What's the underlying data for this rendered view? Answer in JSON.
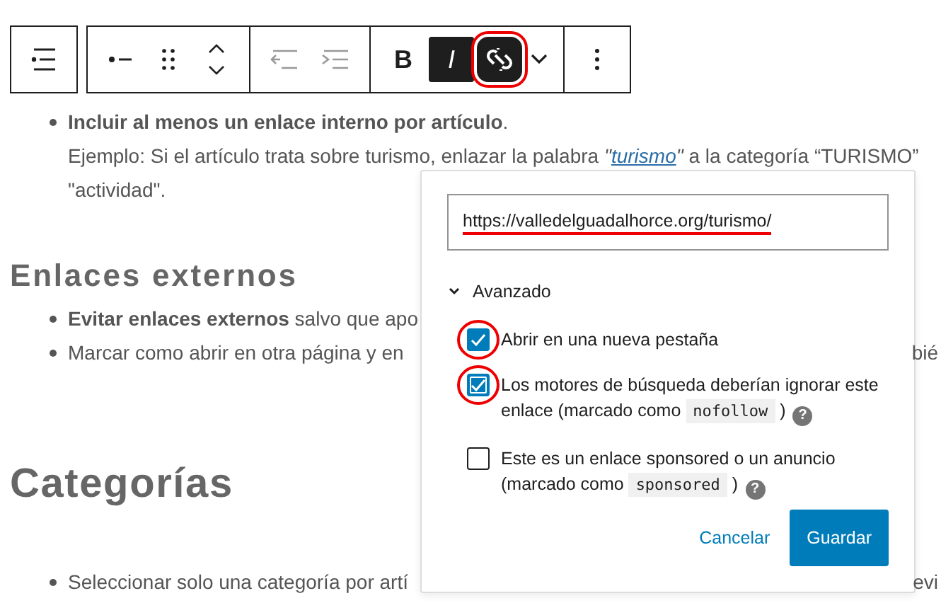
{
  "toolbar": {
    "groups": [
      {
        "buttons": [
          {
            "kind": "list",
            "pressed": false,
            "disabled": false,
            "circled": false
          }
        ]
      },
      {
        "buttons": [
          {
            "kind": "bullet",
            "pressed": false,
            "disabled": false,
            "circled": false
          },
          {
            "kind": "drag",
            "pressed": false,
            "disabled": false,
            "circled": false
          },
          {
            "kind": "updown",
            "pressed": false,
            "disabled": false,
            "circled": false
          }
        ]
      },
      {
        "buttons": [
          {
            "kind": "outdent",
            "pressed": false,
            "disabled": true,
            "circled": false
          },
          {
            "kind": "indent",
            "pressed": false,
            "disabled": true,
            "circled": false
          }
        ]
      },
      {
        "buttons": [
          {
            "kind": "bold",
            "label": "B",
            "pressed": false,
            "disabled": false,
            "circled": false
          },
          {
            "kind": "italic",
            "label": "I",
            "pressed": true,
            "disabled": false,
            "circled": false
          },
          {
            "kind": "unlink",
            "pressed": true,
            "disabled": false,
            "circled": true
          },
          {
            "kind": "chevron",
            "pressed": false,
            "disabled": false,
            "circled": false
          }
        ]
      },
      {
        "buttons": [
          {
            "kind": "more",
            "pressed": false,
            "disabled": false,
            "circled": false
          }
        ]
      }
    ]
  },
  "content": [
    {
      "kind": "bullet",
      "text": "**Incluir al menos un enlace interno por artículo**.",
      "example": {
        "before": "Ejemplo: Si el artículo trata sobre turismo, enlazar la palabra ",
        "link_prefix": "\"",
        "link": "turismo",
        "link_suffix": "\"",
        "after": " a la categoría “TURISMO”"
      },
      "continuation": "\"actividad\"."
    },
    {
      "kind": "subheading",
      "text": "Enlaces externos"
    },
    {
      "kind": "bullet",
      "text": "**Evitar enlaces externos** salvo que apo"
    },
    {
      "kind": "bullet",
      "text": "Marcar como abrir en otra página y en",
      "tail": "bié"
    },
    {
      "kind": "heading",
      "text": "Categorías"
    },
    {
      "kind": "bullet",
      "text": "Seleccionar solo una categoría por artí",
      "tail": "evi"
    }
  ],
  "link_popover": {
    "url": "https://valledelguadalhorce.org/turismo/",
    "url_underlined": true,
    "advanced": {
      "label": "Avanzado",
      "expanded": true
    },
    "options": [
      {
        "label": "Abrir en una nueva pestaña",
        "checked": true,
        "focused": false,
        "circled": true
      },
      {
        "label": "Los motores de búsqueda deberían ignorar este enlace (marcado como ",
        "code": "nofollow",
        "after": " )",
        "help": "?",
        "checked": true,
        "focused": true,
        "circled": true
      },
      {
        "label": "Este es un enlace sponsored o un anuncio (marcado como ",
        "code": "sponsored",
        "after": " )",
        "help": "?",
        "checked": false,
        "focused": false,
        "circled": false
      }
    ],
    "buttons": [
      {
        "kind": "link",
        "label": "Cancelar"
      },
      {
        "kind": "primary",
        "label": "Guardar"
      }
    ]
  }
}
